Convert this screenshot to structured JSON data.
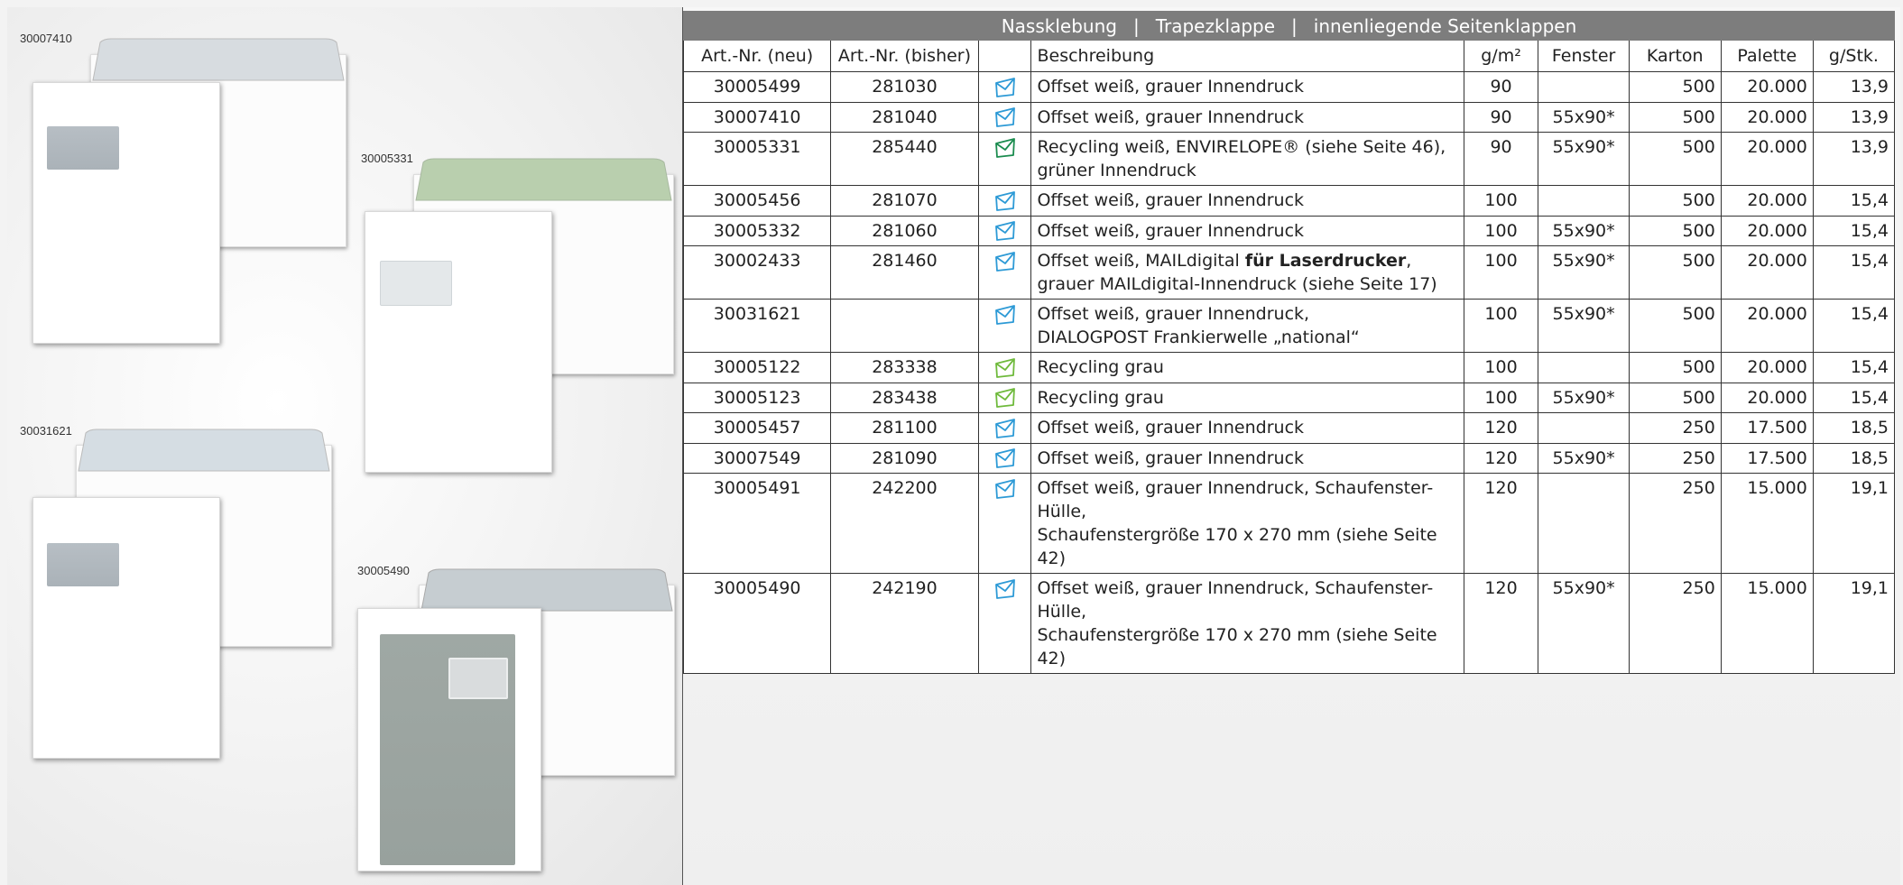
{
  "header": {
    "segments": [
      "Nassklebung",
      "Trapezklappe",
      "innenliegende Seitenklappen"
    ],
    "separator": "|"
  },
  "columns": [
    "Art.-Nr. (neu)",
    "Art.-Nr. (bisher)",
    "",
    "Beschreibung",
    "g/m²",
    "Fenster",
    "Karton",
    "Palette",
    "g/Stk."
  ],
  "product_images": [
    {
      "label": "30007410"
    },
    {
      "label": "30005331"
    },
    {
      "label": "30031621"
    },
    {
      "label": "30005490"
    }
  ],
  "colors": {
    "header_bg": "#7d7d7d",
    "icon_offset": "#2d9ad6",
    "icon_recycling_green": "#1b8c4f",
    "icon_recycling_grey": "#6fba3c"
  },
  "rows": [
    {
      "new": "30005499",
      "old": "281030",
      "icon": "envelope-blue",
      "desc1": "Offset weiß, grauer Innendruck",
      "desc_bold": "",
      "desc_after": "",
      "desc2": "",
      "gram": "90",
      "fenster": "",
      "karton": "500",
      "palette": "20.000",
      "gstk": "13,9"
    },
    {
      "new": "30007410",
      "old": "281040",
      "icon": "envelope-blue",
      "desc1": "Offset weiß, grauer Innendruck",
      "desc_bold": "",
      "desc_after": "",
      "desc2": "",
      "gram": "90",
      "fenster": "55x90*",
      "karton": "500",
      "palette": "20.000",
      "gstk": "13,9"
    },
    {
      "new": "30005331",
      "old": "285440",
      "icon": "envelope-darkgreen",
      "desc1": "Recycling weiß, ENVIRELOPE® (siehe Seite 46),",
      "desc_bold": "",
      "desc_after": "",
      "desc2": "grüner Innendruck",
      "gram": "90",
      "fenster": "55x90*",
      "karton": "500",
      "palette": "20.000",
      "gstk": "13,9"
    },
    {
      "new": "30005456",
      "old": "281070",
      "icon": "envelope-blue",
      "desc1": "Offset weiß, grauer Innendruck",
      "desc_bold": "",
      "desc_after": "",
      "desc2": "",
      "gram": "100",
      "fenster": "",
      "karton": "500",
      "palette": "20.000",
      "gstk": "15,4"
    },
    {
      "new": "30005332",
      "old": "281060",
      "icon": "envelope-blue",
      "desc1": "Offset weiß, grauer Innendruck",
      "desc_bold": "",
      "desc_after": "",
      "desc2": "",
      "gram": "100",
      "fenster": "55x90*",
      "karton": "500",
      "palette": "20.000",
      "gstk": "15,4"
    },
    {
      "new": "30002433",
      "old": "281460",
      "icon": "envelope-blue",
      "desc1": "Offset weiß, MAILdigital ",
      "desc_bold": "für Laserdrucker",
      "desc_after": ",",
      "desc2": "grauer MAILdigital-Innendruck (siehe Seite 17)",
      "gram": "100",
      "fenster": "55x90*",
      "karton": "500",
      "palette": "20.000",
      "gstk": "15,4"
    },
    {
      "new": "30031621",
      "old": "",
      "icon": "envelope-blue",
      "desc1": "Offset weiß, grauer Innendruck,",
      "desc_bold": "",
      "desc_after": "",
      "desc2": "DIALOGPOST Frankierwelle „national“",
      "gram": "100",
      "fenster": "55x90*",
      "karton": "500",
      "palette": "20.000",
      "gstk": "15,4"
    },
    {
      "new": "30005122",
      "old": "283338",
      "icon": "envelope-lightgreen",
      "desc1": "Recycling grau",
      "desc_bold": "",
      "desc_after": "",
      "desc2": "",
      "gram": "100",
      "fenster": "",
      "karton": "500",
      "palette": "20.000",
      "gstk": "15,4"
    },
    {
      "new": "30005123",
      "old": "283438",
      "icon": "envelope-lightgreen",
      "desc1": "Recycling grau",
      "desc_bold": "",
      "desc_after": "",
      "desc2": "",
      "gram": "100",
      "fenster": "55x90*",
      "karton": "500",
      "palette": "20.000",
      "gstk": "15,4"
    },
    {
      "new": "30005457",
      "old": "281100",
      "icon": "envelope-blue",
      "desc1": "Offset weiß, grauer Innendruck",
      "desc_bold": "",
      "desc_after": "",
      "desc2": "",
      "gram": "120",
      "fenster": "",
      "karton": "250",
      "palette": "17.500",
      "gstk": "18,5"
    },
    {
      "new": "30007549",
      "old": "281090",
      "icon": "envelope-blue",
      "desc1": "Offset weiß, grauer Innendruck",
      "desc_bold": "",
      "desc_after": "",
      "desc2": "",
      "gram": "120",
      "fenster": "55x90*",
      "karton": "250",
      "palette": "17.500",
      "gstk": "18,5"
    },
    {
      "new": "30005491",
      "old": "242200",
      "icon": "envelope-blue",
      "desc1": "Offset weiß, grauer Innendruck, Schaufenster-Hülle,",
      "desc_bold": "",
      "desc_after": "",
      "desc2": "Schaufenstergröße 170 x 270 mm (siehe Seite 42)",
      "gram": "120",
      "fenster": "",
      "karton": "250",
      "palette": "15.000",
      "gstk": "19,1"
    },
    {
      "new": "30005490",
      "old": "242190",
      "icon": "envelope-blue",
      "desc1": "Offset weiß, grauer Innendruck, Schaufenster-Hülle,",
      "desc_bold": "",
      "desc_after": "",
      "desc2": "Schaufenstergröße 170 x 270 mm (siehe Seite 42)",
      "gram": "120",
      "fenster": "55x90*",
      "karton": "250",
      "palette": "15.000",
      "gstk": "19,1"
    }
  ]
}
